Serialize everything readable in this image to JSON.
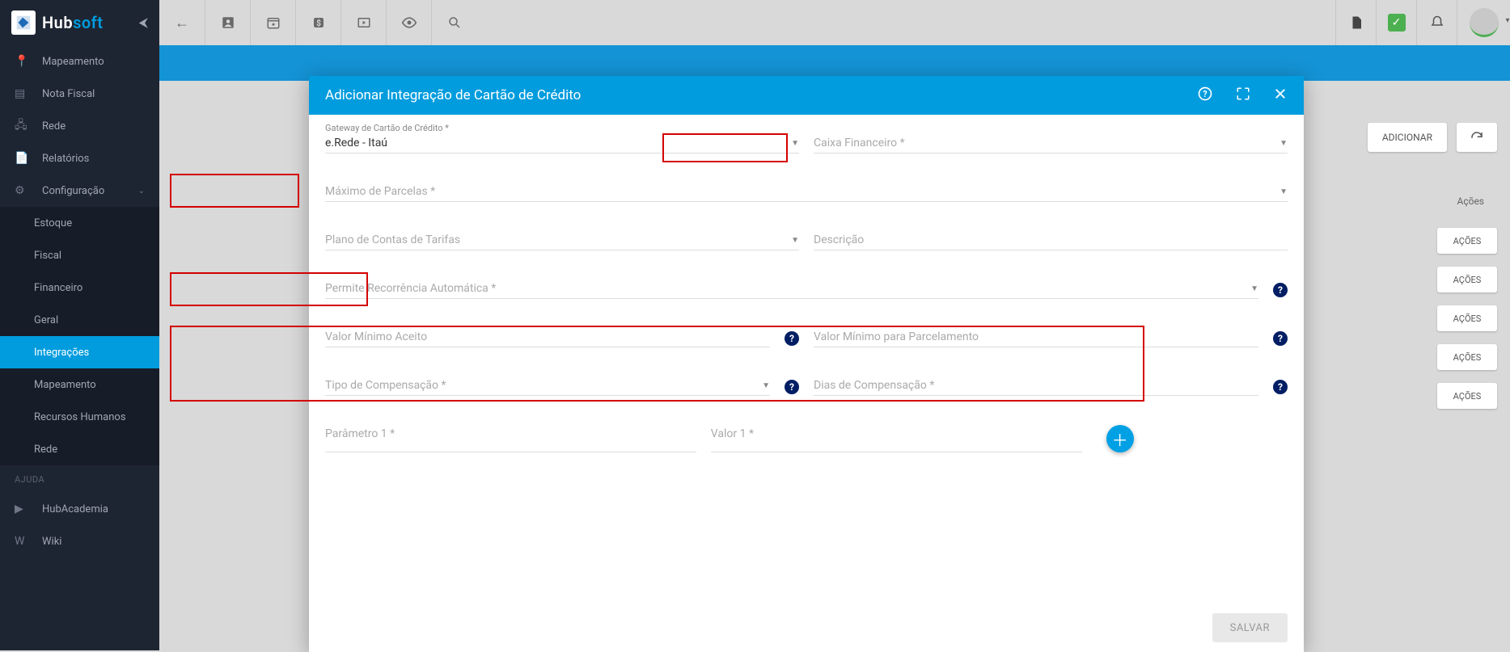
{
  "brand": {
    "hub": "Hub",
    "soft": "soft"
  },
  "sidebar": {
    "items": [
      {
        "label": "Mapeamento",
        "icon": "📍"
      },
      {
        "label": "Nota Fiscal",
        "icon": "▤"
      },
      {
        "label": "Rede",
        "icon": "🖧"
      },
      {
        "label": "Relatórios",
        "icon": "📄"
      },
      {
        "label": "Configuração",
        "icon": "⚙",
        "expandable": true
      }
    ],
    "sub": [
      {
        "label": "Estoque"
      },
      {
        "label": "Fiscal"
      },
      {
        "label": "Financeiro"
      },
      {
        "label": "Geral"
      },
      {
        "label": "Integrações"
      },
      {
        "label": "Mapeamento"
      },
      {
        "label": "Recursos Humanos"
      },
      {
        "label": "Rede"
      }
    ],
    "help_header": "AJUDA",
    "help": [
      {
        "label": "HubAcademia",
        "icon": "▶"
      },
      {
        "label": "Wiki",
        "icon": "W"
      }
    ]
  },
  "topbar": {
    "icons": [
      "←",
      "👤",
      "📅",
      "$",
      "▣",
      "👁",
      "🔍"
    ],
    "right": [
      "📄",
      "check",
      "🔔",
      "avatar"
    ]
  },
  "page": {
    "btn_add": "ADICIONAR",
    "col_acoes": "Ações",
    "row_btn": "AÇÕES",
    "row_tops": [
      226,
      274,
      322,
      370,
      418
    ]
  },
  "modal": {
    "title": "Adicionar Integração de Cartão de Crédito",
    "gateway_label": "Gateway de Cartão de Crédito *",
    "gateway_value": "e.Rede - Itaú",
    "caixa_label": "Caixa Financeiro *",
    "parcelas_label": "Máximo de Parcelas *",
    "plano_label": "Plano de Contas de Tarifas",
    "descricao_label": "Descrição",
    "recorrencia_label": "Permite Recorrência Automática *",
    "valmin_label": "Valor Mínimo Aceito",
    "valminparc_label": "Valor Mínimo para Parcelamento",
    "tipocomp_label": "Tipo de Compensação *",
    "diascomp_label": "Dias de Compensação *",
    "param1_label": "Parâmetro 1 *",
    "valor1_label": "Valor 1 *",
    "btn_salvar": "SALVAR"
  }
}
